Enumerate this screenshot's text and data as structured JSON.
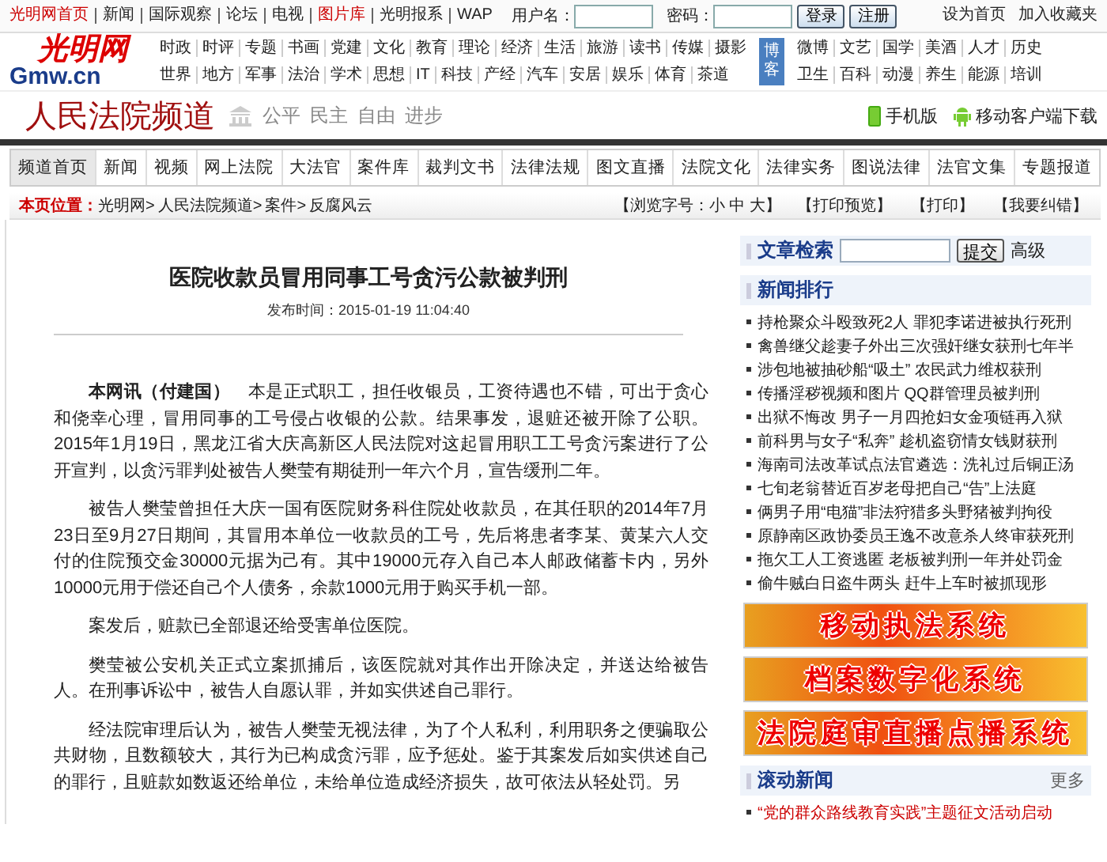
{
  "top_bar": {
    "links": [
      {
        "label": "光明网首页",
        "highlight": true
      },
      {
        "label": "新闻",
        "highlight": false
      },
      {
        "label": "国际观察",
        "highlight": false
      },
      {
        "label": "论坛",
        "highlight": false
      },
      {
        "label": "电视",
        "highlight": false
      },
      {
        "label": "图片库",
        "highlight": true
      },
      {
        "label": "光明报系",
        "highlight": false
      },
      {
        "label": "WAP",
        "highlight": false
      }
    ],
    "username_label": "用户名：",
    "password_label": "密码：",
    "buttons": [
      "登录",
      "注册"
    ],
    "right_links": [
      "设为首页",
      "加入收藏夹"
    ]
  },
  "logo": {
    "name": "光明网",
    "domain": "Gmw.cn"
  },
  "portal_nav": {
    "left_rows": [
      [
        "时政",
        "时评",
        "专题",
        "书画",
        "党建",
        "文化",
        "教育",
        "理论",
        "经济",
        "生活",
        "旅游",
        "读书",
        "传媒",
        "摄影"
      ],
      [
        "世界",
        "地方",
        "军事",
        "法治",
        "学术",
        "思想",
        "IT",
        "科技",
        "产经",
        "汽车",
        "安居",
        "娱乐",
        "体育",
        "茶道"
      ]
    ],
    "featured": "博客",
    "right_rows": [
      [
        "微博",
        "文艺",
        "国学",
        "美酒",
        "人才",
        "历史"
      ],
      [
        "卫生",
        "百科",
        "动漫",
        "养生",
        "能源",
        "培训"
      ]
    ]
  },
  "channel": {
    "title": "人民法院频道",
    "slogan": [
      "公平",
      "民主",
      "自由",
      "进步"
    ],
    "links": [
      "手机版",
      "移动客户端下载"
    ]
  },
  "tabs": [
    {
      "label": "频道首页",
      "selected": true
    },
    {
      "label": "新闻",
      "selected": false
    },
    {
      "label": "视频",
      "selected": false
    },
    {
      "label": "网上法院",
      "selected": false
    },
    {
      "label": "大法官",
      "selected": false
    },
    {
      "label": "案件库",
      "selected": false
    },
    {
      "label": "裁判文书",
      "selected": false
    },
    {
      "label": "法律法规",
      "selected": false
    },
    {
      "label": "图文直播",
      "selected": false
    },
    {
      "label": "法院文化",
      "selected": false
    },
    {
      "label": "法律实务",
      "selected": false
    },
    {
      "label": "图说法律",
      "selected": false
    },
    {
      "label": "法官文集",
      "selected": false
    },
    {
      "label": "专题报道",
      "selected": false
    }
  ],
  "breadcrumb": {
    "label": "本页位置：",
    "items": [
      "光明网>",
      "人民法院频道>",
      "案件>",
      "反腐风云"
    ],
    "font_size": "【浏览字号：小 中 大】",
    "tools": [
      "【打印预览】",
      "【打印】",
      "【我要纠错】"
    ]
  },
  "article": {
    "title": "医院收款员冒用同事工号贪污公款被判刑",
    "date": "发布时间：2015-01-19 11:04:40",
    "paragraphs": [
      "**本网讯（付建国）**　本是正式职工，担任收银员，工资待遇也不错，可出于贪心和侥幸心理，冒用同事的工号侵占收银的公款。结果事发，退赃还被开除了公职。2015年1月19日，黑龙江省大庆高新区人民法院对这起冒用职工工号贪污案进行了公开宣判，以贪污罪判处被告人樊莹有期徒刑一年六个月，宣告缓刑二年。",
      "被告人樊莹曾担任大庆一国有医院财务科住院处收款员，在其任职的2014年7月23日至9月27日期间，其冒用本单位一收款员的工号，先后将患者李某、黄某六人交付的住院预交金30000元据为己有。其中19000元存入自己本人邮政储蓄卡内，另外10000元用于偿还自己个人债务，余款1000元用于购买手机一部。",
      "案发后，赃款已全部退还给受害单位医院。",
      "樊莹被公安机关正式立案抓捕后，该医院就对其作出开除决定，并送达给被告人。在刑事诉讼中，被告人自愿认罪，并如实供述自己罪行。",
      "经法院审理后认为，被告人樊莹无视法律，为了个人私利，利用职务之便骗取公共财物，且数额较大，其行为已构成贪污罪，应予惩处。鉴于其案发后如实供述自己的罪行，且赃款如数返还给单位，未给单位造成经济损失，故可依法从轻处罚。另"
    ]
  },
  "sidebar": {
    "search": {
      "title": "文章检索",
      "button": "提交",
      "advanced": "高级"
    },
    "ranking": {
      "title": "新闻排行",
      "items": [
        "持枪聚众斗殴致死2人 罪犯李诺进被执行死刑",
        "禽兽继父趁妻子外出三次强奸继女获刑七年半",
        "涉包地被抽砂船“吸土” 农民武力维权获刑",
        "传播淫秽视频和图片 QQ群管理员被判刑",
        "出狱不悔改 男子一月四抢妇女金项链再入狱",
        "前科男与女子“私奔” 趁机盗窃情女钱财获刑",
        "海南司法改革试点法官遴选：洗礼过后铜正汤",
        "七旬老翁替近百岁老母把自己“告”上法庭",
        "俩男子用“电猫”非法狩猎多头野猪被判拘役",
        "原静南区政协委员王逸不改意杀人终审获死刑",
        "拖欠工人工资逃匿 老板被判刑一年并处罚金",
        "偷牛贼白日盗牛两头 赶牛上车时被抓现形"
      ]
    },
    "banners": [
      "移动执法系统",
      "档案数字化系统",
      "法院庭审直播点播系统"
    ],
    "rolling": {
      "title": "滚动新闻",
      "more": "更多",
      "items": [
        "“党的群众路线教育实践”主题征文活动启动"
      ]
    }
  }
}
